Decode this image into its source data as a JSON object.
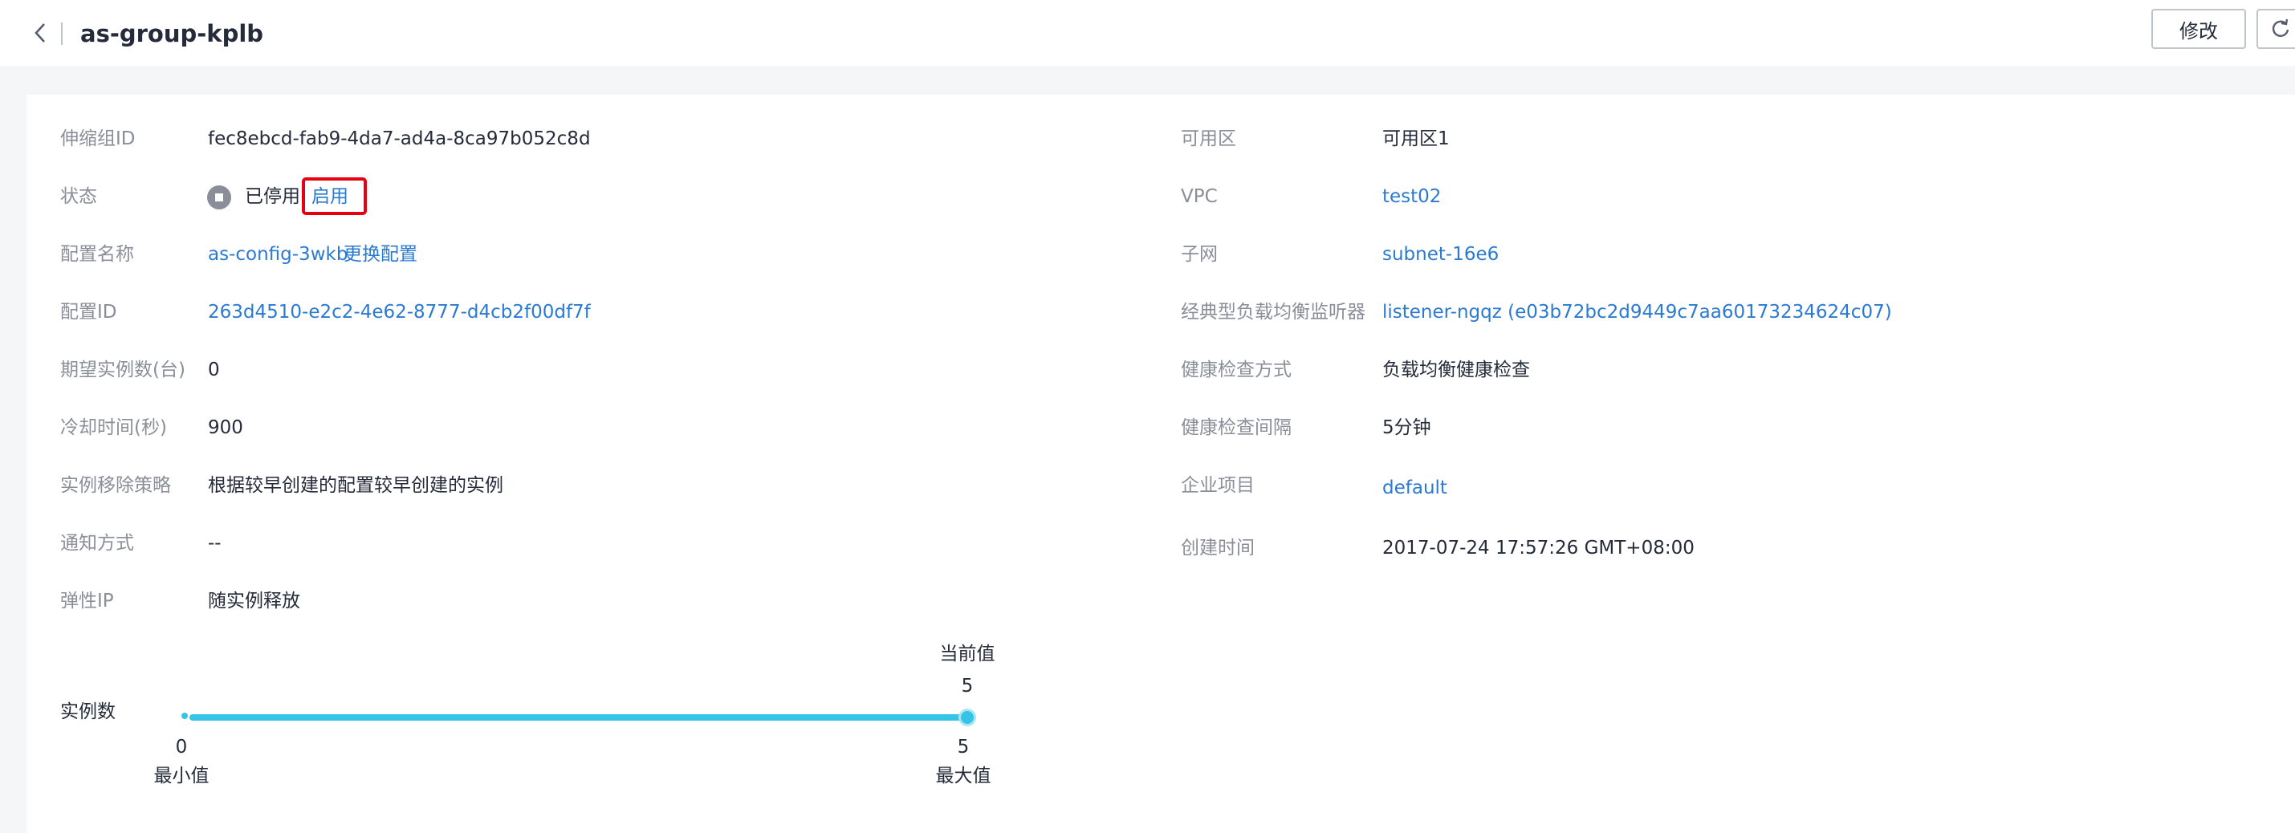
{
  "header": {
    "title": "as-group-kplb",
    "edit_label": "修改"
  },
  "left": {
    "group_id_label": "伸缩组ID",
    "group_id_value": "fec8ebcd-fab9-4da7-ad4a-8ca97b052c8d",
    "status_label": "状态",
    "status_value": "已停用",
    "status_action": "启用",
    "config_name_label": "配置名称",
    "config_name_value": "as-config-3wkb",
    "config_change": "更换配置",
    "config_id_label": "配置ID",
    "config_id_value": "263d4510-e2c2-4e62-8777-d4cb2f00df7f",
    "desired_label": "期望实例数(台)",
    "desired_value": "0",
    "cooldown_label": "冷却时间(秒)",
    "cooldown_value": "900",
    "removal_label": "实例移除策略",
    "removal_value": "根据较早创建的配置较早创建的实例",
    "notify_label": "通知方式",
    "notify_value": "--",
    "eip_label": "弹性IP",
    "eip_value": "随实例释放"
  },
  "right": {
    "az_label": "可用区",
    "az_value": "可用区1",
    "vpc_label": "VPC",
    "vpc_value": "test02",
    "subnet_label": "子网",
    "subnet_value": "subnet-16e6",
    "elb_label": "经典型负载均衡监听器",
    "elb_value": "listener-ngqz (e03b72bc2d9449c7aa60173234624c07)",
    "health_method_label": "健康检查方式",
    "health_method_value": "负载均衡健康检查",
    "health_interval_label": "健康检查间隔",
    "health_interval_value": "5分钟",
    "project_label": "企业项目",
    "project_value": "default",
    "created_label": "创建时间",
    "created_value": "2017-07-24 17:57:26 GMT+08:00"
  },
  "instances": {
    "label": "实例数",
    "current_label": "当前值",
    "current_value": "5",
    "min_value": "0",
    "min_label": "最小值",
    "max_value": "5",
    "max_label": "最大值"
  },
  "colors": {
    "link": "#2b7ad2",
    "slider": "#36c4e6",
    "highlight": "#e60012"
  },
  "icons": {
    "back": "chevron-left-icon",
    "refresh": "refresh-icon",
    "status": "stopped-status-icon"
  }
}
